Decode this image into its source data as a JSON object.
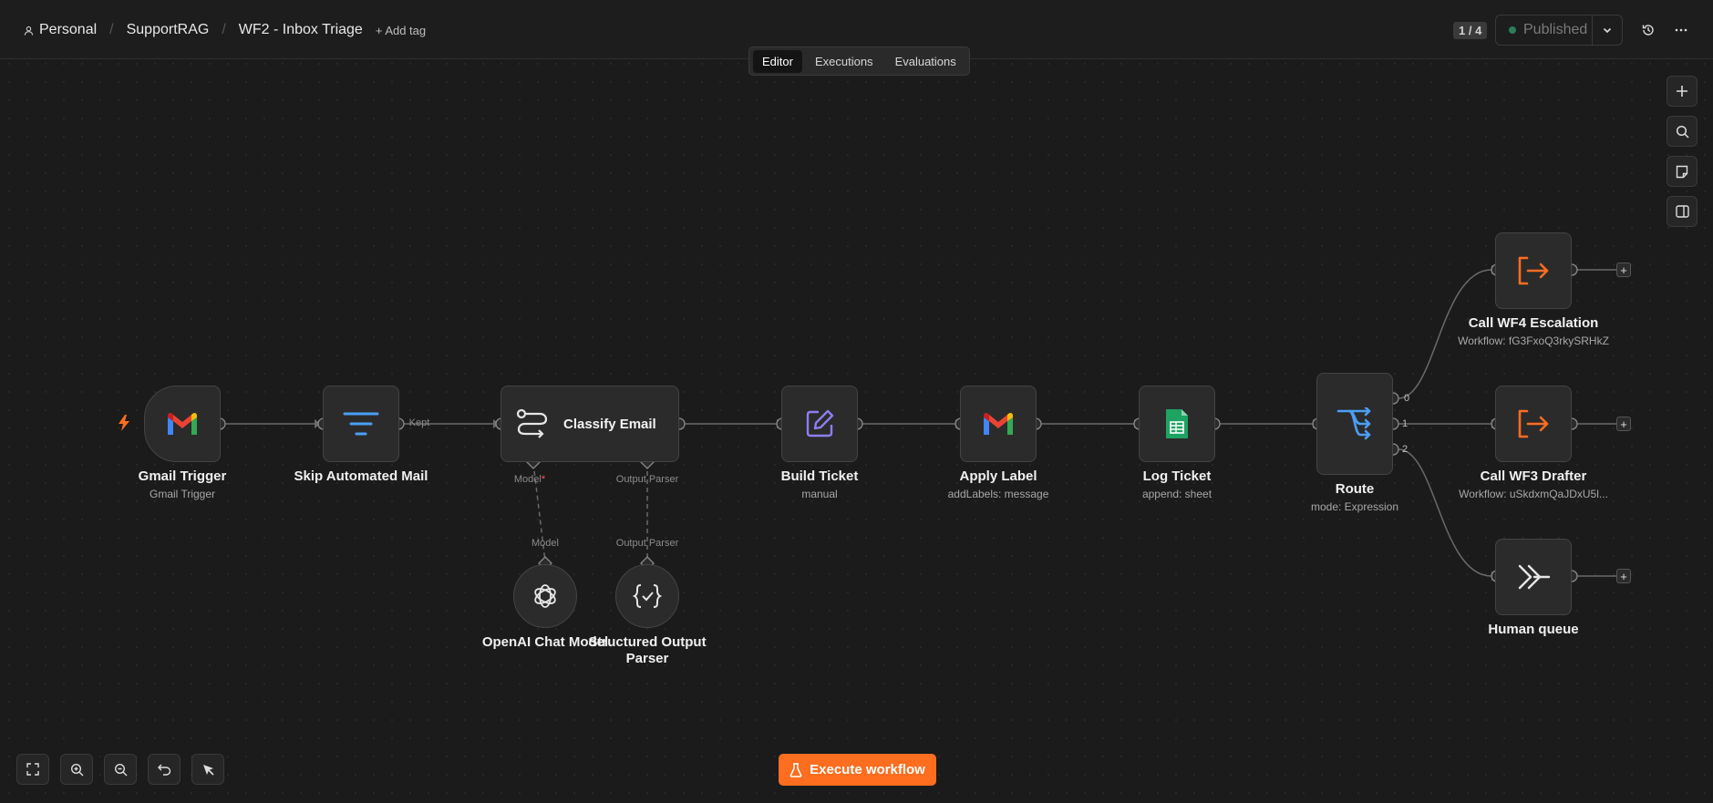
{
  "breadcrumb": {
    "personal": "Personal",
    "project": "SupportRAG",
    "workflow": "WF2 - Inbox Triage",
    "add_tag": "+ Add tag"
  },
  "header": {
    "counter": "1 / 4",
    "published": "Published"
  },
  "tabs": [
    "Editor",
    "Executions",
    "Evaluations"
  ],
  "nodes": {
    "gmail_trigger": {
      "title": "Gmail Trigger",
      "sub": "Gmail Trigger"
    },
    "skip": {
      "title": "Skip Automated Mail",
      "kept": "Kept"
    },
    "classify": {
      "title": "Classify Email",
      "model_label": "Model",
      "required": "*",
      "parser_label": "Output Parser"
    },
    "openai": {
      "title": "OpenAI Chat Model",
      "port": "Model"
    },
    "parser": {
      "title": "Structured Output",
      "title2": "Parser",
      "port": "Output Parser"
    },
    "build": {
      "title": "Build Ticket",
      "sub": "manual"
    },
    "apply": {
      "title": "Apply Label",
      "sub": "addLabels: message"
    },
    "log": {
      "title": "Log Ticket",
      "sub": "append: sheet"
    },
    "route": {
      "title": "Route",
      "sub": "mode: Expression",
      "outputs": [
        "0",
        "1",
        "2"
      ]
    },
    "wf4": {
      "title": "Call WF4 Escalation",
      "sub": "Workflow: fG3FxoQ3rkySRHkZ"
    },
    "wf3": {
      "title": "Call WF3 Drafter",
      "sub": "Workflow: uSkdxmQaJDxU5l..."
    },
    "human": {
      "title": "Human queue"
    }
  },
  "actions": {
    "execute": "Execute workflow"
  },
  "colors": {
    "accent": "#ff6d1f",
    "published_dot": "#2e7d59",
    "filter_blue": "#4a9ff5",
    "sheets_green": "#1ea362",
    "edit_purple": "#8c7ff0"
  },
  "icons": {
    "side": [
      "plus-icon",
      "search-icon",
      "note-icon",
      "panel-icon"
    ],
    "controls": [
      "fit-view-icon",
      "zoom-in-icon",
      "zoom-out-icon",
      "undo-icon",
      "cursor-icon"
    ]
  }
}
